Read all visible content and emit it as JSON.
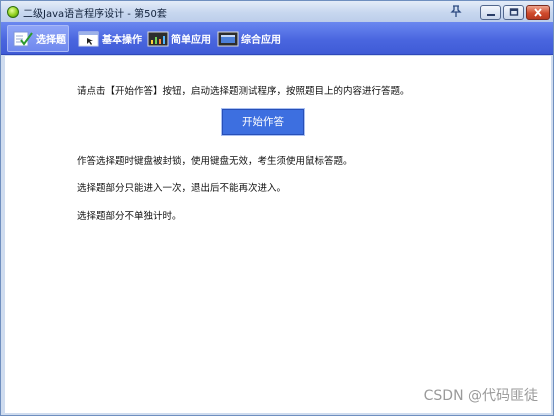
{
  "window": {
    "title": "二级Java语言程序设计 - 第50套",
    "buttons": {
      "pin": "pin-icon",
      "minimize": "minimize-icon",
      "maximize": "maximize-icon",
      "close": "close-icon"
    }
  },
  "toolbar": {
    "tabs": [
      {
        "label": "选择题",
        "icon": "checklist-icon",
        "active": true
      },
      {
        "label": "基本操作",
        "icon": "window-cursor-icon",
        "active": false
      },
      {
        "label": "简单应用",
        "icon": "monitor-chart-icon",
        "active": false
      },
      {
        "label": "综合应用",
        "icon": "monitor-app-icon",
        "active": false
      }
    ]
  },
  "content": {
    "instruction": "请点击【开始作答】按钮，启动选择题测试程序，按照题目上的内容进行答题。",
    "start_button": "开始作答",
    "note1": "作答选择题时键盘被封锁，使用键盘无效，考生须使用鼠标答题。",
    "note2": "选择题部分只能进入一次，退出后不能再次进入。",
    "note3": "选择题部分不单独计时。"
  },
  "watermark": "CSDN @代码匪徒",
  "colors": {
    "toolbar": "#4a66df",
    "start_button": "#3d6fe0",
    "titlebar": "#c7d7ef"
  }
}
